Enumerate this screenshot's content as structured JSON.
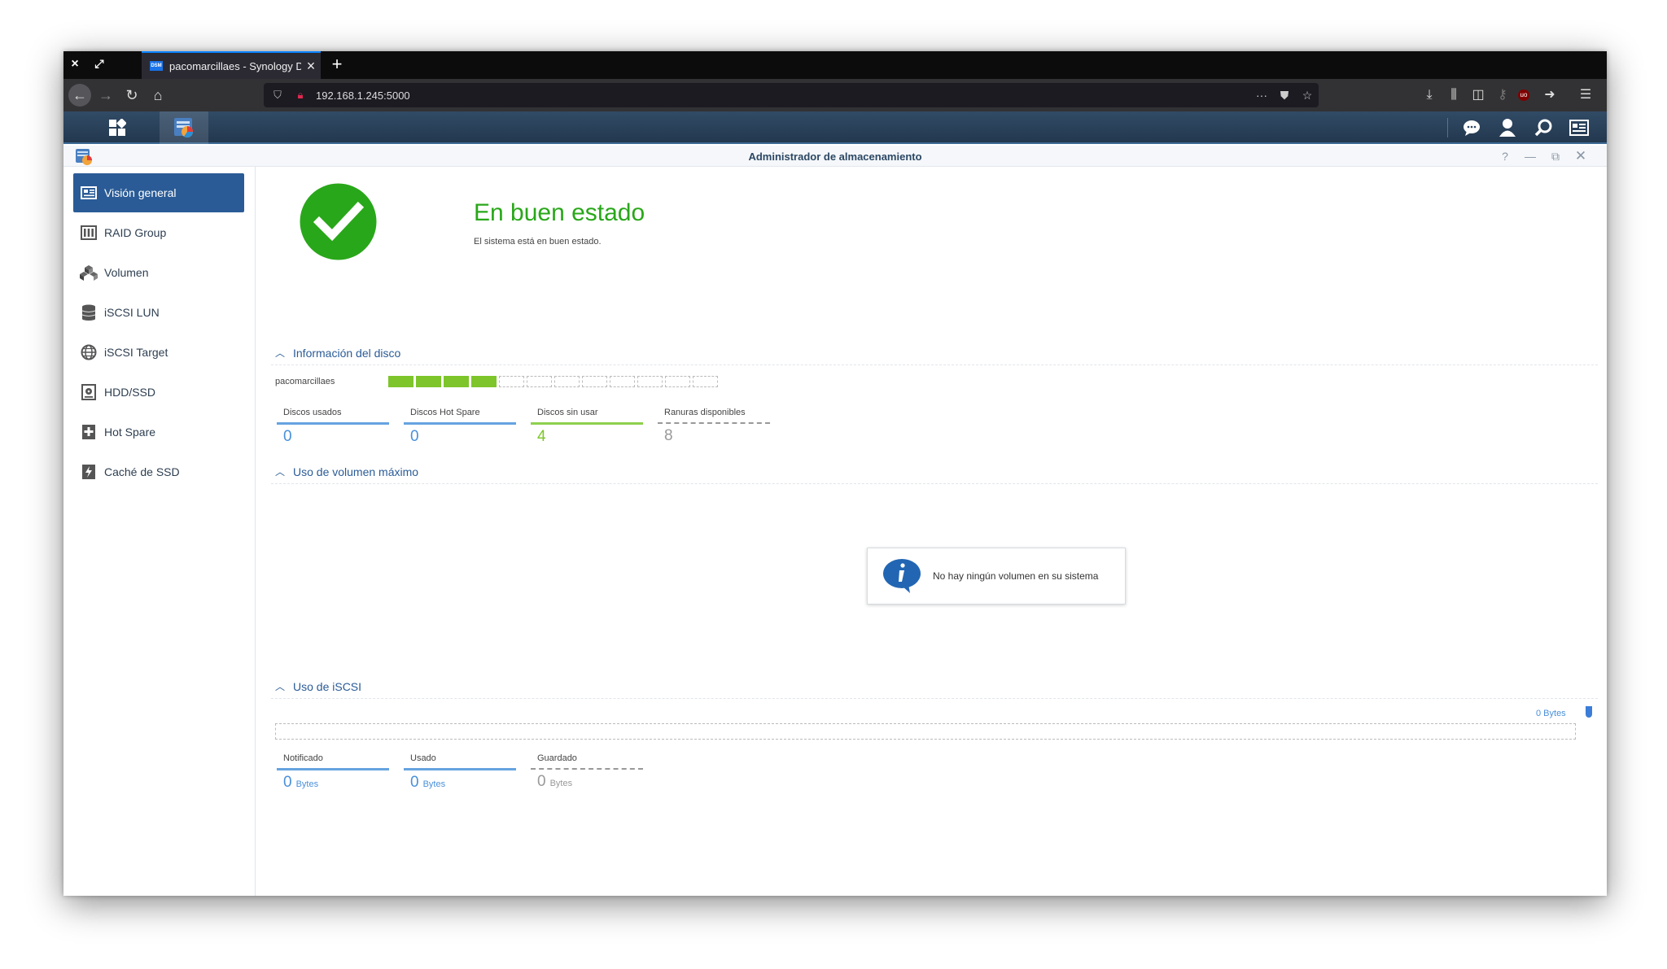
{
  "browser": {
    "tab_title": "pacomarcillaes - Synology Di",
    "tab_favicon_text": "DSM",
    "url": "192.168.1.245:5000",
    "page_actions_icon": "···"
  },
  "app": {
    "title": "Administrador de almacenamiento"
  },
  "sidebar": {
    "items": [
      {
        "label": "Visión general",
        "icon": "overview-icon"
      },
      {
        "label": "RAID Group",
        "icon": "raid-group-icon"
      },
      {
        "label": "Volumen",
        "icon": "volume-icon"
      },
      {
        "label": "iSCSI LUN",
        "icon": "iscsi-lun-icon"
      },
      {
        "label": "iSCSI Target",
        "icon": "iscsi-target-icon"
      },
      {
        "label": "HDD/SSD",
        "icon": "hdd-icon"
      },
      {
        "label": "Hot Spare",
        "icon": "hot-spare-icon"
      },
      {
        "label": "Caché de SSD",
        "icon": "ssd-cache-icon"
      }
    ]
  },
  "status": {
    "title": "En buen estado",
    "subtitle": "El sistema está en buen estado."
  },
  "disk_info": {
    "heading": "Información del disco",
    "server_name": "pacomarcillaes",
    "slots_used": 4,
    "slots_total": 12,
    "stats": [
      {
        "label": "Discos usados",
        "value": "0"
      },
      {
        "label": "Discos Hot Spare",
        "value": "0"
      },
      {
        "label": "Discos sin usar",
        "value": "4"
      },
      {
        "label": "Ranuras disponibles",
        "value": "8"
      }
    ]
  },
  "volume_usage": {
    "heading": "Uso de volumen máximo",
    "empty_message": "No hay ningún volumen en su sistema"
  },
  "iscsi_usage": {
    "heading": "Uso de iSCSI",
    "bar_label": "0 Bytes",
    "stats": [
      {
        "label": "Notificado",
        "value": "0",
        "unit": "Bytes"
      },
      {
        "label": "Usado",
        "value": "0",
        "unit": "Bytes"
      },
      {
        "label": "Guardado",
        "value": "0",
        "unit": "Bytes"
      }
    ]
  },
  "colors": {
    "accent": "#2a5b96",
    "healthy": "#29a71a",
    "disk_used": "#7dc52a"
  }
}
